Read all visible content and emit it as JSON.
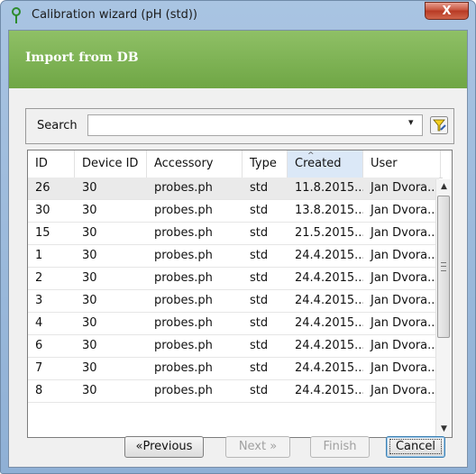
{
  "window": {
    "title": "Calibration wizard (pH (std))",
    "close_glyph": "X"
  },
  "header": {
    "title": "Import from DB",
    "color": "#78ad4f"
  },
  "search": {
    "label": "Search",
    "value": "",
    "dropdown_glyph": "▾",
    "filter_icon": "filter-icon"
  },
  "grid": {
    "columns": [
      "ID",
      "Device ID",
      "Accessory",
      "Type",
      "Created",
      "User"
    ],
    "sorted_column": "Created",
    "rows": [
      [
        "26",
        "30",
        "probes.ph",
        "std",
        "11.8.2015...",
        "Jan Dvora..."
      ],
      [
        "30",
        "30",
        "probes.ph",
        "std",
        "13.8.2015...",
        "Jan Dvora..."
      ],
      [
        "15",
        "30",
        "probes.ph",
        "std",
        "21.5.2015...",
        "Jan Dvora..."
      ],
      [
        "1",
        "30",
        "probes.ph",
        "std",
        "24.4.2015...",
        "Jan Dvora..."
      ],
      [
        "2",
        "30",
        "probes.ph",
        "std",
        "24.4.2015...",
        "Jan Dvora..."
      ],
      [
        "3",
        "30",
        "probes.ph",
        "std",
        "24.4.2015...",
        "Jan Dvora..."
      ],
      [
        "4",
        "30",
        "probes.ph",
        "std",
        "24.4.2015...",
        "Jan Dvora..."
      ],
      [
        "6",
        "30",
        "probes.ph",
        "std",
        "24.4.2015...",
        "Jan Dvora..."
      ],
      [
        "7",
        "30",
        "probes.ph",
        "std",
        "24.4.2015...",
        "Jan Dvora..."
      ],
      [
        "8",
        "30",
        "probes.ph",
        "std",
        "24.4.2015...",
        "Jan Dvora..."
      ]
    ],
    "selected_row": 0,
    "scroll_up": "▲",
    "scroll_down": "▼"
  },
  "buttons": {
    "previous": "«Previous",
    "next": "Next »",
    "finish": "Finish",
    "cancel": "Cancel"
  }
}
